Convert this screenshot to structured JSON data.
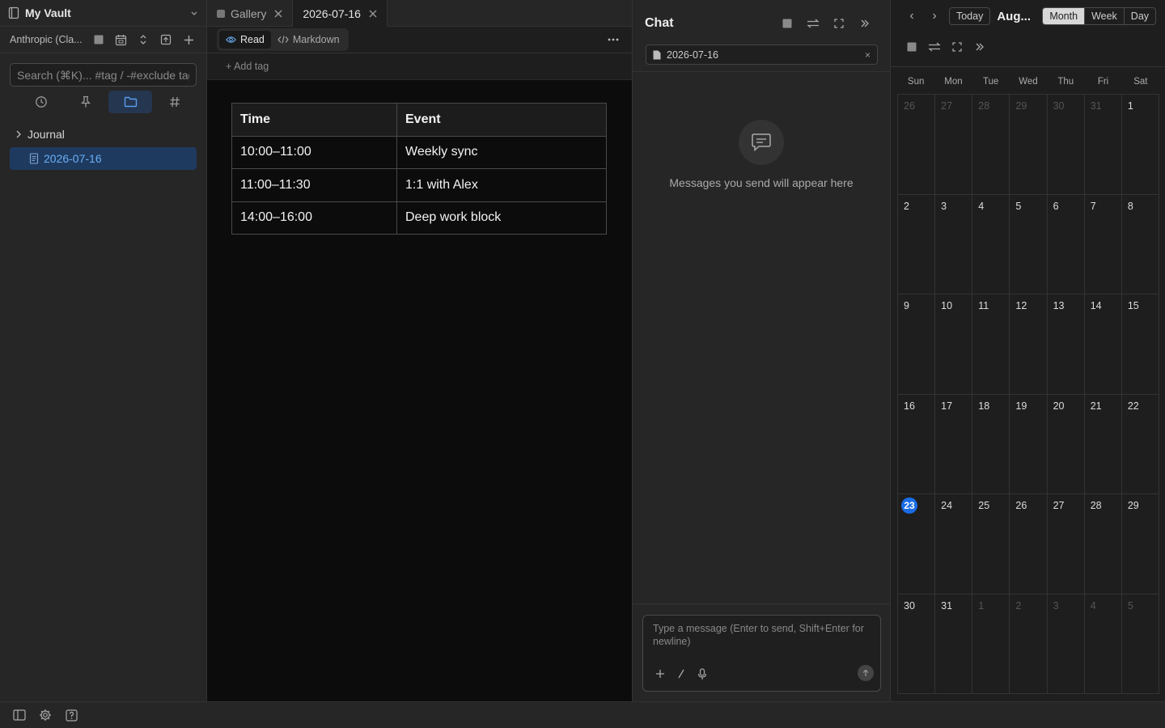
{
  "sidebar": {
    "vault_name": "My Vault",
    "model_label": "Anthropic (Cla...",
    "search_placeholder": "Search (⌘K)... #tag / -#exclude tag",
    "tree": {
      "folder": "Journal",
      "file": "2026-07-16"
    }
  },
  "editor": {
    "tabs": [
      {
        "label": "Gallery"
      },
      {
        "label": "2026-07-16"
      }
    ],
    "mode_read": "Read",
    "mode_markdown": "Markdown",
    "add_tag": "+ Add tag",
    "table": {
      "headers": [
        "Time",
        "Event"
      ],
      "rows": [
        [
          "10:00–11:00",
          "Weekly sync"
        ],
        [
          "11:00–11:30",
          "1:1 with Alex"
        ],
        [
          "14:00–16:00",
          "Deep work block"
        ]
      ]
    }
  },
  "chat": {
    "title": "Chat",
    "context_file": "2026-07-16",
    "context_close": "×",
    "empty_text": "Messages you send will appear here",
    "input_placeholder": "Type a message (Enter to send, Shift+Enter for newline)"
  },
  "calendar": {
    "prev": "‹",
    "next": "›",
    "today_label": "Today",
    "title": "Aug...",
    "views": [
      "Month",
      "Week",
      "Day"
    ],
    "active_view": "Month",
    "weekdays": [
      "Sun",
      "Mon",
      "Tue",
      "Wed",
      "Thu",
      "Fri",
      "Sat"
    ],
    "days": [
      {
        "n": "26",
        "other": true
      },
      {
        "n": "27",
        "other": true
      },
      {
        "n": "28",
        "other": true
      },
      {
        "n": "29",
        "other": true
      },
      {
        "n": "30",
        "other": true
      },
      {
        "n": "31",
        "other": true
      },
      {
        "n": "1"
      },
      {
        "n": "2"
      },
      {
        "n": "3"
      },
      {
        "n": "4"
      },
      {
        "n": "5"
      },
      {
        "n": "6"
      },
      {
        "n": "7"
      },
      {
        "n": "8"
      },
      {
        "n": "9"
      },
      {
        "n": "10"
      },
      {
        "n": "11"
      },
      {
        "n": "12"
      },
      {
        "n": "13"
      },
      {
        "n": "14"
      },
      {
        "n": "15"
      },
      {
        "n": "16"
      },
      {
        "n": "17"
      },
      {
        "n": "18"
      },
      {
        "n": "19"
      },
      {
        "n": "20"
      },
      {
        "n": "21"
      },
      {
        "n": "22"
      },
      {
        "n": "23",
        "today": true
      },
      {
        "n": "24"
      },
      {
        "n": "25"
      },
      {
        "n": "26"
      },
      {
        "n": "27"
      },
      {
        "n": "28"
      },
      {
        "n": "29"
      },
      {
        "n": "30"
      },
      {
        "n": "31"
      },
      {
        "n": "1",
        "other": true
      },
      {
        "n": "2",
        "other": true
      },
      {
        "n": "3",
        "other": true
      },
      {
        "n": "4",
        "other": true
      },
      {
        "n": "5",
        "other": true
      }
    ],
    "today_color": "#1a6ce6"
  },
  "colors": {
    "accent": "#5b9cf0",
    "selected_bg": "#1f3a5f"
  }
}
